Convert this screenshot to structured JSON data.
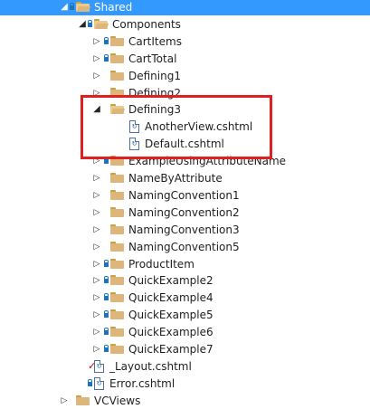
{
  "tree": [
    {
      "label": "Shared",
      "depth": 0,
      "arrow": "expanded",
      "lock": true,
      "icon": "folder-open",
      "selected": true
    },
    {
      "label": "Components",
      "depth": 1,
      "arrow": "expanded",
      "lock": true,
      "icon": "folder-open"
    },
    {
      "label": "CartItems",
      "depth": 2,
      "arrow": "collapsed",
      "lock": true,
      "icon": "folder"
    },
    {
      "label": "CartTotal",
      "depth": 2,
      "arrow": "collapsed",
      "lock": true,
      "icon": "folder"
    },
    {
      "label": "Defining1",
      "depth": 2,
      "arrow": "collapsed",
      "lock": false,
      "icon": "folder"
    },
    {
      "label": "Defining2",
      "depth": 2,
      "arrow": "collapsed",
      "lock": false,
      "icon": "folder"
    },
    {
      "label": "Defining3",
      "depth": 2,
      "arrow": "expanded",
      "lock": false,
      "icon": "folder-open"
    },
    {
      "label": "AnotherView.cshtml",
      "depth": 3,
      "arrow": "none",
      "lock": false,
      "icon": "file"
    },
    {
      "label": "Default.cshtml",
      "depth": 3,
      "arrow": "none",
      "lock": false,
      "icon": "file"
    },
    {
      "label": "ExampleUsingAttributeName",
      "depth": 2,
      "arrow": "collapsed",
      "lock": true,
      "icon": "folder"
    },
    {
      "label": "NameByAttribute",
      "depth": 2,
      "arrow": "collapsed",
      "lock": false,
      "icon": "folder"
    },
    {
      "label": "NamingConvention1",
      "depth": 2,
      "arrow": "collapsed",
      "lock": false,
      "icon": "folder"
    },
    {
      "label": "NamingConvention2",
      "depth": 2,
      "arrow": "collapsed",
      "lock": false,
      "icon": "folder"
    },
    {
      "label": "NamingConvention3",
      "depth": 2,
      "arrow": "collapsed",
      "lock": false,
      "icon": "folder"
    },
    {
      "label": "NamingConvention5",
      "depth": 2,
      "arrow": "collapsed",
      "lock": false,
      "icon": "folder"
    },
    {
      "label": "ProductItem",
      "depth": 2,
      "arrow": "collapsed",
      "lock": true,
      "icon": "folder"
    },
    {
      "label": "QuickExample2",
      "depth": 2,
      "arrow": "collapsed",
      "lock": true,
      "icon": "folder"
    },
    {
      "label": "QuickExample4",
      "depth": 2,
      "arrow": "collapsed",
      "lock": true,
      "icon": "folder"
    },
    {
      "label": "QuickExample5",
      "depth": 2,
      "arrow": "collapsed",
      "lock": true,
      "icon": "folder"
    },
    {
      "label": "QuickExample6",
      "depth": 2,
      "arrow": "collapsed",
      "lock": true,
      "icon": "folder"
    },
    {
      "label": "QuickExample7",
      "depth": 2,
      "arrow": "collapsed",
      "lock": true,
      "icon": "folder"
    },
    {
      "label": "_Layout.cshtml",
      "depth": 1,
      "arrow": "none",
      "lock": false,
      "check": true,
      "icon": "file"
    },
    {
      "label": "Error.cshtml",
      "depth": 1,
      "arrow": "none",
      "lock": true,
      "icon": "file"
    },
    {
      "label": "VCViews",
      "depth": 0,
      "arrow": "collapsed",
      "lock": false,
      "icon": "folder"
    }
  ],
  "colors": {
    "selection": "#3399ff",
    "highlight_border": "#e02020",
    "lock": "#1c75bc",
    "folder": "#dcb67a"
  }
}
